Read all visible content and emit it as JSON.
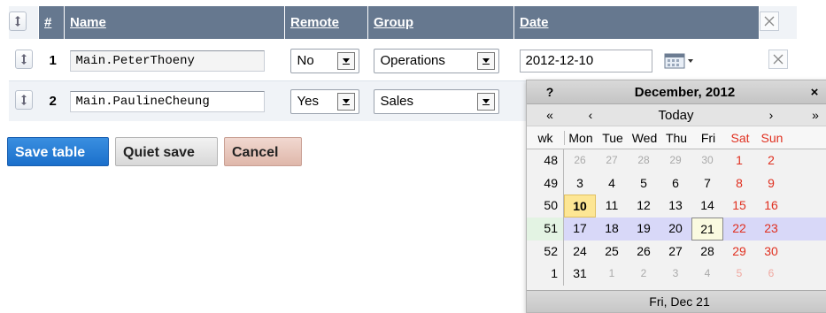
{
  "table": {
    "headers": {
      "number": "#",
      "name": "Name",
      "remote": "Remote",
      "group": "Group",
      "date": "Date"
    },
    "rows": [
      {
        "number": "1",
        "name": "Main.PeterThoeny",
        "remote": "No",
        "group": "Operations",
        "date": "2012-12-10"
      },
      {
        "number": "2",
        "name": "Main.PaulineCheung",
        "remote": "Yes",
        "group": "Sales",
        "date": ""
      }
    ]
  },
  "buttons": {
    "save": "Save table",
    "quiet_save": "Quiet save",
    "cancel": "Cancel"
  },
  "calendar": {
    "help": "?",
    "title": "December, 2012",
    "close": "×",
    "nav": {
      "prev_year": "«",
      "prev_month": "‹",
      "today": "Today",
      "next_month": "›",
      "next_year": "»"
    },
    "week_header": "wk",
    "days": [
      "Mon",
      "Tue",
      "Wed",
      "Thu",
      "Fri",
      "Sat",
      "Sun"
    ],
    "weeks": [
      {
        "wk": "48",
        "d": [
          "26",
          "27",
          "28",
          "29",
          "30",
          "1",
          "2"
        ]
      },
      {
        "wk": "49",
        "d": [
          "3",
          "4",
          "5",
          "6",
          "7",
          "8",
          "9"
        ]
      },
      {
        "wk": "50",
        "d": [
          "10",
          "11",
          "12",
          "13",
          "14",
          "15",
          "16"
        ]
      },
      {
        "wk": "51",
        "d": [
          "17",
          "18",
          "19",
          "20",
          "21",
          "22",
          "23"
        ]
      },
      {
        "wk": "52",
        "d": [
          "24",
          "25",
          "26",
          "27",
          "28",
          "29",
          "30"
        ]
      },
      {
        "wk": "1",
        "d": [
          "31",
          "1",
          "2",
          "3",
          "4",
          "5",
          "6"
        ]
      }
    ],
    "footer": "Fri, Dec 21"
  },
  "colors": {
    "header_bg": "#66788f",
    "save_button": "#1b6fcb",
    "cancel_button": "#dfb7aa",
    "weekend": "#e03020",
    "today_highlight": "#fde694"
  }
}
